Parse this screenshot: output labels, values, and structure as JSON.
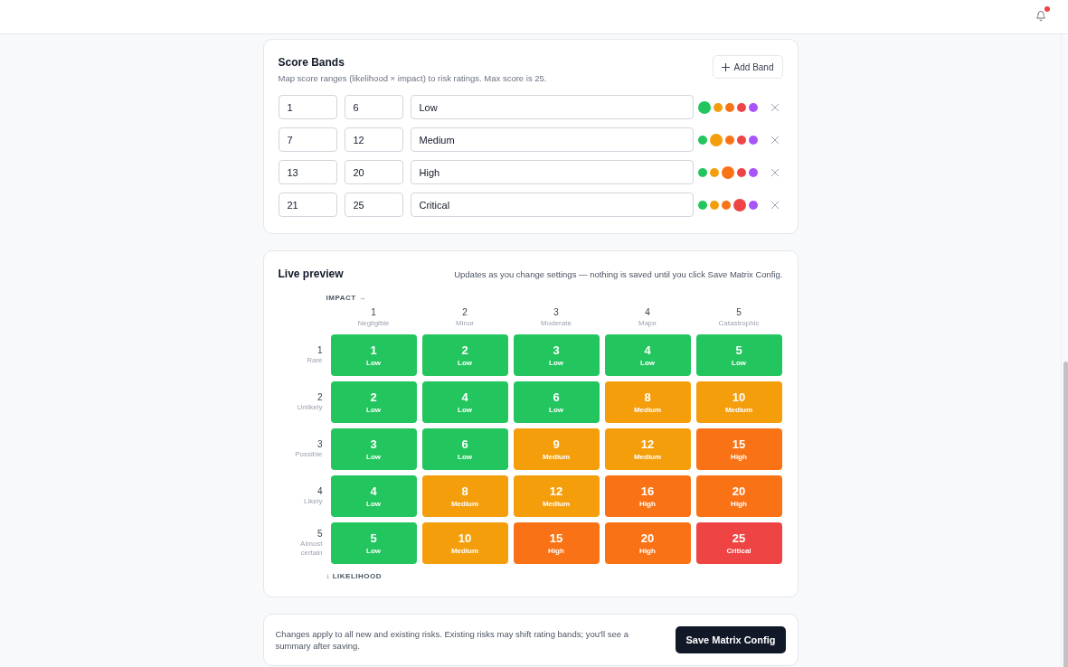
{
  "header": {
    "unread_notifications": true
  },
  "score_bands": {
    "title": "Score Bands",
    "description": "Map score ranges (likelihood × impact) to risk ratings. Max score is 25.",
    "add_button": "Add Band",
    "bands": [
      {
        "min": "1",
        "max": "6",
        "label": "Low",
        "swatches": [
          {
            "color": "#22c55e",
            "selected": true
          },
          {
            "color": "#f59e0b",
            "selected": false
          },
          {
            "color": "#f97316",
            "selected": false
          },
          {
            "color": "#ef4444",
            "selected": false
          },
          {
            "color": "#a855f7",
            "selected": false
          }
        ]
      },
      {
        "min": "7",
        "max": "12",
        "label": "Medium",
        "swatches": [
          {
            "color": "#22c55e",
            "selected": false
          },
          {
            "color": "#f59e0b",
            "selected": true
          },
          {
            "color": "#f97316",
            "selected": false
          },
          {
            "color": "#ef4444",
            "selected": false
          },
          {
            "color": "#a855f7",
            "selected": false
          }
        ]
      },
      {
        "min": "13",
        "max": "20",
        "label": "High",
        "swatches": [
          {
            "color": "#22c55e",
            "selected": false
          },
          {
            "color": "#f59e0b",
            "selected": false
          },
          {
            "color": "#f97316",
            "selected": true
          },
          {
            "color": "#ef4444",
            "selected": false
          },
          {
            "color": "#a855f7",
            "selected": false
          }
        ]
      },
      {
        "min": "21",
        "max": "25",
        "label": "Critical",
        "swatches": [
          {
            "color": "#22c55e",
            "selected": false
          },
          {
            "color": "#f59e0b",
            "selected": false
          },
          {
            "color": "#f97316",
            "selected": false
          },
          {
            "color": "#ef4444",
            "selected": true
          },
          {
            "color": "#a855f7",
            "selected": false
          }
        ]
      }
    ]
  },
  "live_preview": {
    "title": "Live preview",
    "note": "Updates as you change settings — nothing is saved until you click Save Matrix Config.",
    "impact_axis": "IMPACT →",
    "columns": [
      {
        "number": "1",
        "name": "Negligible"
      },
      {
        "number": "2",
        "name": "Minor"
      },
      {
        "number": "3",
        "name": "Moderate"
      },
      {
        "number": "4",
        "name": "Major"
      },
      {
        "number": "5",
        "name": "Catastrophic"
      }
    ],
    "rows": [
      {
        "number": "1",
        "name": "Rare",
        "cells": [
          {
            "score": "1",
            "rating": "Low",
            "color": "#22c55e"
          },
          {
            "score": "2",
            "rating": "Low",
            "color": "#22c55e"
          },
          {
            "score": "3",
            "rating": "Low",
            "color": "#22c55e"
          },
          {
            "score": "4",
            "rating": "Low",
            "color": "#22c55e"
          },
          {
            "score": "5",
            "rating": "Low",
            "color": "#22c55e"
          }
        ]
      },
      {
        "number": "2",
        "name": "Unlikely",
        "cells": [
          {
            "score": "2",
            "rating": "Low",
            "color": "#22c55e"
          },
          {
            "score": "4",
            "rating": "Low",
            "color": "#22c55e"
          },
          {
            "score": "6",
            "rating": "Low",
            "color": "#22c55e"
          },
          {
            "score": "8",
            "rating": "Medium",
            "color": "#f59e0b"
          },
          {
            "score": "10",
            "rating": "Medium",
            "color": "#f59e0b"
          }
        ]
      },
      {
        "number": "3",
        "name": "Possible",
        "cells": [
          {
            "score": "3",
            "rating": "Low",
            "color": "#22c55e"
          },
          {
            "score": "6",
            "rating": "Low",
            "color": "#22c55e"
          },
          {
            "score": "9",
            "rating": "Medium",
            "color": "#f59e0b"
          },
          {
            "score": "12",
            "rating": "Medium",
            "color": "#f59e0b"
          },
          {
            "score": "15",
            "rating": "High",
            "color": "#f97316"
          }
        ]
      },
      {
        "number": "4",
        "name": "Likely",
        "cells": [
          {
            "score": "4",
            "rating": "Low",
            "color": "#22c55e"
          },
          {
            "score": "8",
            "rating": "Medium",
            "color": "#f59e0b"
          },
          {
            "score": "12",
            "rating": "Medium",
            "color": "#f59e0b"
          },
          {
            "score": "16",
            "rating": "High",
            "color": "#f97316"
          },
          {
            "score": "20",
            "rating": "High",
            "color": "#f97316"
          }
        ]
      },
      {
        "number": "5",
        "name": "Almost certain",
        "cells": [
          {
            "score": "5",
            "rating": "Low",
            "color": "#22c55e"
          },
          {
            "score": "10",
            "rating": "Medium",
            "color": "#f59e0b"
          },
          {
            "score": "15",
            "rating": "High",
            "color": "#f97316"
          },
          {
            "score": "20",
            "rating": "High",
            "color": "#f97316"
          },
          {
            "score": "25",
            "rating": "Critical",
            "color": "#ef4444"
          }
        ]
      }
    ],
    "likelihood_axis": "↓ LIKELIHOOD"
  },
  "footer": {
    "note": "Changes apply to all new and existing risks. Existing risks may shift rating bands; you'll see a summary after saving.",
    "save_button": "Save Matrix Config"
  }
}
